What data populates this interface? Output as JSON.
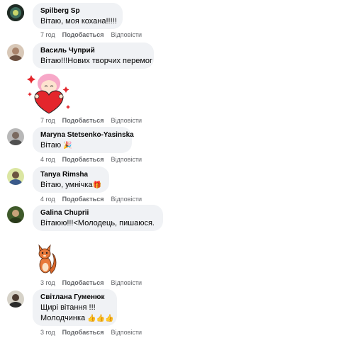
{
  "comments": [
    {
      "author": "Spilberg Sp",
      "text": "Вітаю, моя кохана!!!!!",
      "time": "7 год",
      "like": "Подобається",
      "reply": "Відповісти"
    },
    {
      "author": "Василь Чуприй",
      "text": "Вітаю!!!Нових творчих перемог",
      "time": "7 год",
      "like": "Подобається",
      "reply": "Відповісти",
      "sticker": "girl-heart-sticker"
    },
    {
      "author": "Maryna Stetsenko-Yasinska",
      "text": "Вітаю",
      "emoji": "🎉",
      "time": "4 год",
      "like": "Подобається",
      "reply": "Відповісти"
    },
    {
      "author": "Tanya Rimsha",
      "text": "Вітаю, умнічка",
      "emoji": "🎁",
      "time": "4 год",
      "like": "Подобається",
      "reply": "Відповісти"
    },
    {
      "author": "Galina Chuprii",
      "text": "Вітаюю!!!<Молодець, пишаюся.",
      "time": "3 год",
      "like": "Подобається",
      "reply": "Відповісти",
      "sticker": "squirrel-sticker"
    },
    {
      "author": "Світлана Гуменюк",
      "text_line1": "Щирі вітання !!!",
      "text_line2": "Молодчинка",
      "emoji": "👍👍👍",
      "time": "3 год",
      "like": "Подобається",
      "reply": "Відповісти"
    }
  ],
  "colors": {
    "bubble": "#f0f2f5",
    "meta": "#65676b",
    "heart": "#e4262c",
    "hair": "#f7a8c8"
  }
}
